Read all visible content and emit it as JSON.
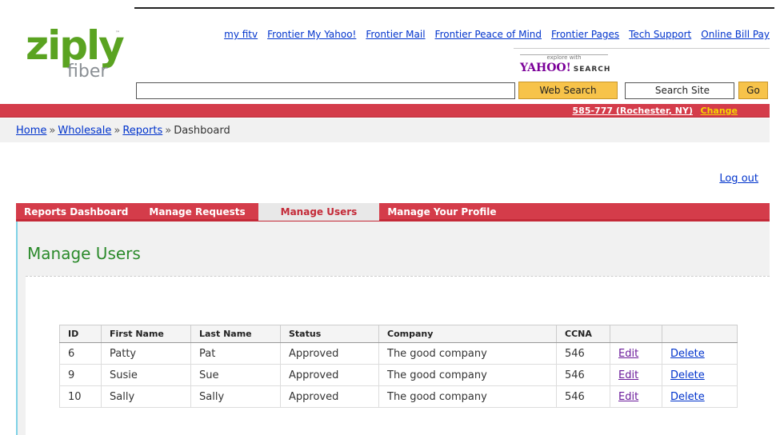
{
  "logo": {
    "main": "ziply",
    "sub": "fiber",
    "tm": "™"
  },
  "top_nav": [
    {
      "label": "my fitv"
    },
    {
      "label": "Frontier My Yahoo!"
    },
    {
      "label": "Frontier Mail"
    },
    {
      "label": "Frontier Peace of Mind"
    },
    {
      "label": "Frontier Pages"
    },
    {
      "label": "Tech Support"
    },
    {
      "label": "Online Bill Pay"
    }
  ],
  "yahoo": {
    "explore": "explore with",
    "brand": "YAHOO!",
    "search_word": "SEARCH"
  },
  "search": {
    "web_search_label": "Web Search",
    "site_search_value": "Search Site",
    "go_label": "Go"
  },
  "location": {
    "text": "585-777 (Rochester, NY)",
    "change_label": "Change"
  },
  "breadcrumb": {
    "items": [
      "Home",
      "Wholesale",
      "Reports"
    ],
    "current": "Dashboard",
    "separator": "»"
  },
  "logout_label": "Log out",
  "tabs": [
    {
      "label": "Reports Dashboard"
    },
    {
      "label": "Manage Requests"
    },
    {
      "label": "Manage Users"
    },
    {
      "label": "Manage Your Profile"
    }
  ],
  "page_title": "Manage Users",
  "table": {
    "headers": [
      "ID",
      "First Name",
      "Last Name",
      "Status",
      "Company",
      "CCNA",
      "",
      ""
    ],
    "rows": [
      {
        "id": "6",
        "first": "Patty",
        "last": "Pat",
        "status": "Approved",
        "company": "The good company",
        "ccna": "546",
        "edit": "Edit",
        "delete": "Delete"
      },
      {
        "id": "9",
        "first": "Susie",
        "last": "Sue",
        "status": "Approved",
        "company": "The good company",
        "ccna": "546",
        "edit": "Edit",
        "delete": "Delete"
      },
      {
        "id": "10",
        "first": "Sally",
        "last": "Sally",
        "status": "Approved",
        "company": "The good company",
        "ccna": "546",
        "edit": "Edit",
        "delete": "Delete"
      }
    ]
  }
}
